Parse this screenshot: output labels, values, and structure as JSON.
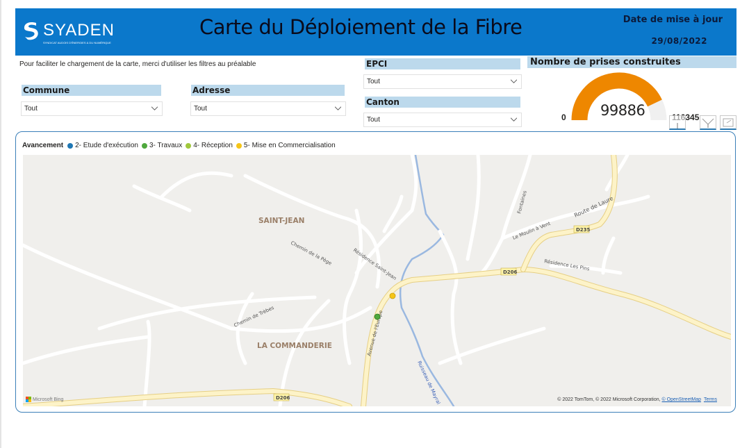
{
  "header": {
    "logo_name": "SYADEN",
    "logo_subtitle": "SYNDICAT AUDOIS D'ÉNERGIES & DU NUMÉRIQUE",
    "title": "Carte du Déploiement de la Fibre",
    "update_label": "Date de mise à jour",
    "update_date": "29/08/2022",
    "brand_color": "#0b78cb"
  },
  "hint": "Pour faciliter le chargement de la carte, merci d'utiliser les filtres au préalable",
  "filters": {
    "commune": {
      "label": "Commune",
      "value": "Tout"
    },
    "adresse": {
      "label": "Adresse",
      "value": "Tout"
    },
    "epci": {
      "label": "EPCI",
      "value": "Tout"
    },
    "canton": {
      "label": "Canton",
      "value": "Tout"
    }
  },
  "gauge": {
    "title": "Nombre de prises construites",
    "value": 99886,
    "value_label": "99886",
    "min": 0,
    "min_label": "0",
    "max": 116345,
    "max_label": "116345",
    "fill_color": "#ee8700",
    "track_color": "#f0f0f0"
  },
  "visual_header_icons": [
    "more-options-icon",
    "filter-icon",
    "focus-mode-icon"
  ],
  "legend": {
    "title": "Avancement",
    "items": [
      {
        "label": "2- Etude d'exécution",
        "color": "#1f77b4"
      },
      {
        "label": "3- Travaux",
        "color": "#4fa83d"
      },
      {
        "label": "4- Réception",
        "color": "#a0c83c"
      },
      {
        "label": "5- Mise en Commercialisation",
        "color": "#f5c518"
      }
    ]
  },
  "map": {
    "place_labels": [
      "SAINT-JEAN",
      "LA COMMANDERIE"
    ],
    "street_labels": [
      "Chemin de la Pège",
      "Résidence Saint-Jean",
      "Chemin de Trèbes",
      "Avenue de l'Europe",
      "Ruisseau de Mayral",
      "Fontaines",
      "Le Moulin à Vent",
      "Route de Laure",
      "Résidence Les Pins"
    ],
    "road_shields": [
      "D235",
      "D206",
      "D206"
    ],
    "points": [
      {
        "status": "5- Mise en Commercialisation",
        "color": "#f5c518"
      },
      {
        "status": "3- Travaux",
        "color": "#4fa83d"
      }
    ],
    "bing_label": "Microsoft Bing",
    "attribution": "© 2022 TomTom, © 2022 Microsoft Corporation,",
    "osm_link": "© OpenStreetMap",
    "terms_link": "Terms"
  }
}
